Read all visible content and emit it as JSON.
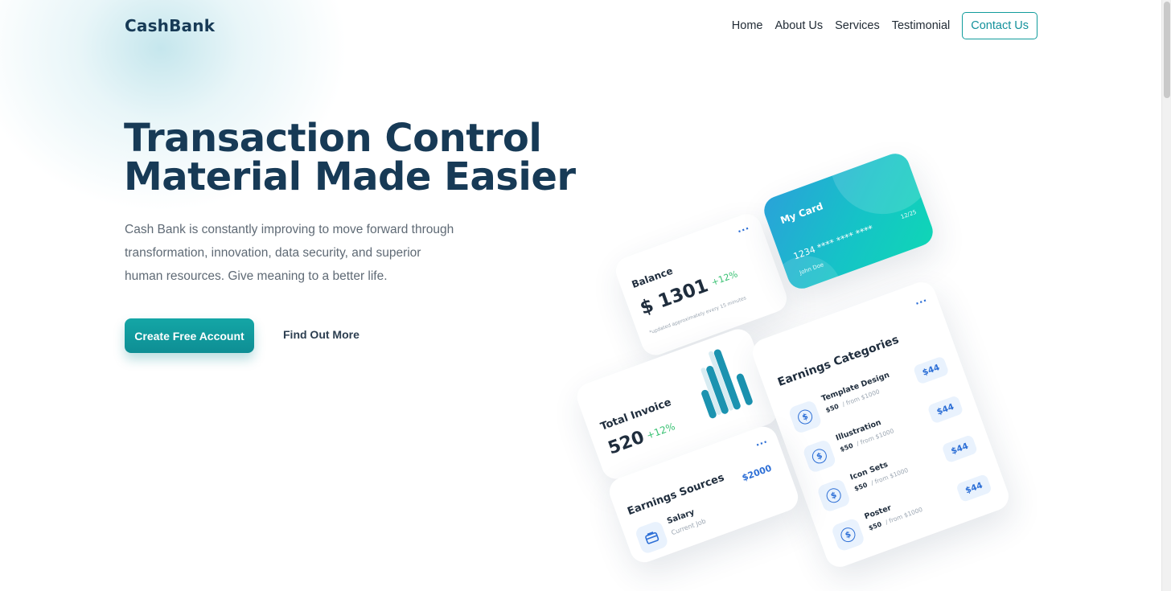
{
  "header": {
    "logo": "CashBank",
    "nav": [
      "Home",
      "About Us",
      "Services",
      "Testimonial"
    ],
    "contact_label": "Contact Us"
  },
  "hero": {
    "title_line1": "Transaction Control",
    "title_line2": "Material Made Easier",
    "description": "Cash Bank is constantly improving to move forward through transformation, innovation, data security, and superior human resources. Give meaning to a better life.",
    "cta_primary": "Create Free Account",
    "cta_secondary": "Find Out More"
  },
  "dashboard": {
    "balance": {
      "title": "Balance",
      "amount": "$ 1301",
      "change": "+12%",
      "note": "*updated approximately every 15 minutes",
      "menu": "..."
    },
    "my_card": {
      "title": "My Card",
      "number": "1234 **** **** ****",
      "expiry": "12/25",
      "holder": "John Doe"
    },
    "total_invoice": {
      "title": "Total Invoice",
      "value": "520",
      "change": "+12%"
    },
    "earnings_categories": {
      "title": "Earnings Categories",
      "menu": "...",
      "items": [
        {
          "name": "Template Design",
          "price": "$50",
          "from": "/ from $1000",
          "badge": "$44"
        },
        {
          "name": "Illustration",
          "price": "$50",
          "from": "/ from $1000",
          "badge": "$44"
        },
        {
          "name": "Icon Sets",
          "price": "$50",
          "from": "/ from $1000",
          "badge": "$44"
        },
        {
          "name": "Poster",
          "price": "$50",
          "from": "/ from $1000",
          "badge": "$44"
        }
      ]
    },
    "earnings_sources": {
      "title": "Earnings Sources",
      "item": "Salary",
      "sub": "Current Job",
      "amount": "$2000",
      "menu": "..."
    }
  },
  "colors": {
    "primary": "#14a6a6",
    "navy": "#173a56",
    "green": "#38c172",
    "blue": "#2d6fd6"
  }
}
